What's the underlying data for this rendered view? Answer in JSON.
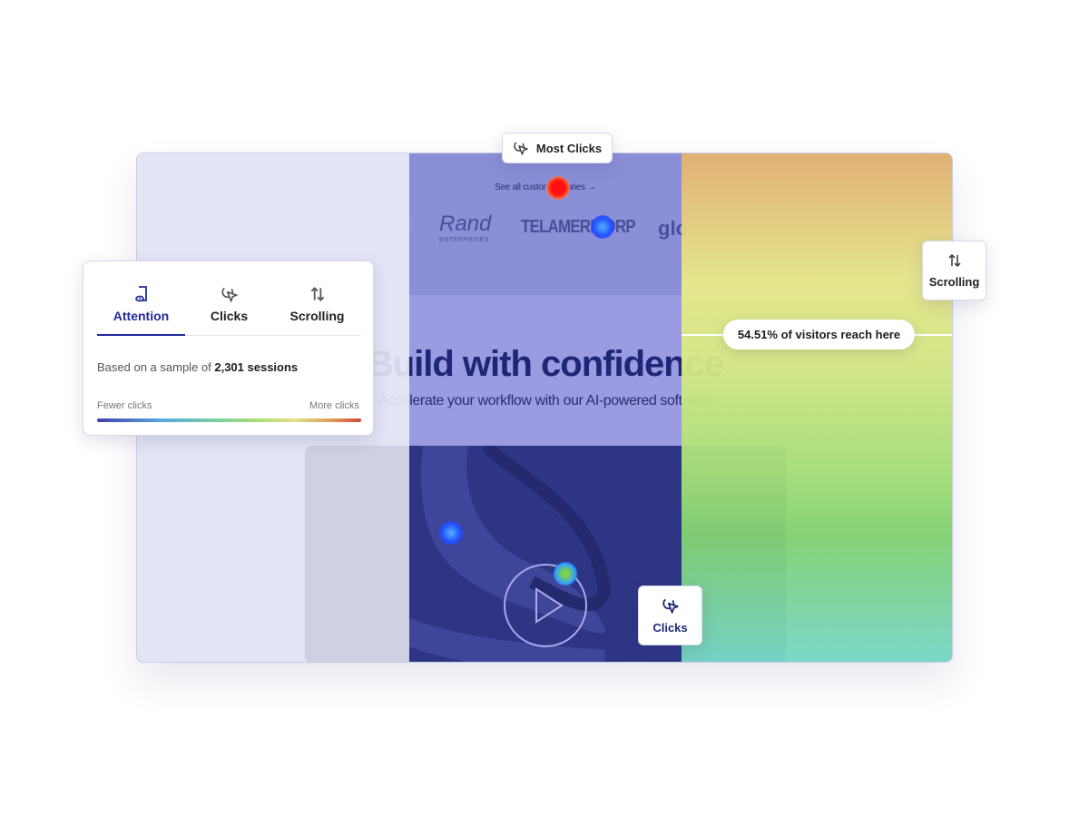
{
  "page": {
    "see_all_link": "See all customer stories →",
    "logos": [
      "Rand",
      "ENTERPRISES",
      "TELAMERICORP",
      "glo"
    ],
    "headline": "Build with confidence",
    "subheadline": "Accelerate your workflow with our AI-powered software"
  },
  "badges": {
    "most_clicks": "Most Clicks",
    "scrolling": "Scrolling",
    "clicks": "Clicks",
    "scroll_reach": "54.51% of visitors reach here"
  },
  "panel": {
    "tabs": [
      {
        "label": "Attention",
        "icon": "attention-icon",
        "active": true
      },
      {
        "label": "Clicks",
        "icon": "cursor-click-icon",
        "active": false
      },
      {
        "label": "Scrolling",
        "icon": "arrows-up-down-icon",
        "active": false
      }
    ],
    "sample_prefix": "Based on a sample of ",
    "sample_value": "2,301 sessions",
    "legend_min": "Fewer clicks",
    "legend_max": "More clicks"
  },
  "colors": {
    "accent": "#1f2a9a",
    "heat_low": "#3f3fb0",
    "heat_high": "#d8443a"
  }
}
